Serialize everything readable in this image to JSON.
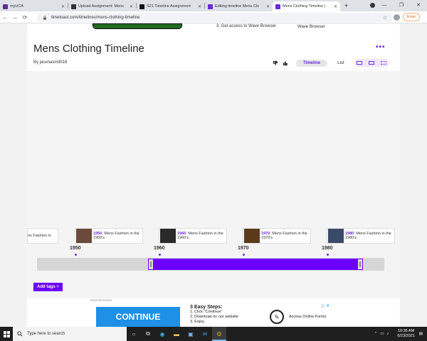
{
  "browser": {
    "tabs": [
      {
        "label": "myUCA",
        "color": "#5c2d91",
        "active": false
      },
      {
        "label": "Upload Assignment: Mens",
        "color": "#333333",
        "active": false
      },
      {
        "label": "S21 Timeline Assignment",
        "color": "#111111",
        "active": false
      },
      {
        "label": "Editing timeline Mens Clo",
        "color": "#6b28e0",
        "active": false
      },
      {
        "label": "Mens Clothing Timeline |",
        "color": "#6b28e0",
        "active": true
      }
    ],
    "new_tab": "+",
    "url": "timetoast.com/timelines/mens-clothing-timeline",
    "error_label": "Error"
  },
  "top_ad": {
    "line1": "3. Get access to Wave Browser",
    "line2": "Wave Browser"
  },
  "page": {
    "title": "Mens Clothing Timeline",
    "byline_prefix": "By",
    "author": "jacenasmith16",
    "more": "•••",
    "view_timeline": "Timeline",
    "view_list": "List",
    "add_tags": "Add tags +"
  },
  "events": [
    {
      "year": "",
      "text": "ns Fashion in",
      "thumb": "#8a7a6a"
    },
    {
      "year": "1950",
      "text": ": Mens Fashion in the 1950's",
      "thumb": "#6a4a3a"
    },
    {
      "year": "1960",
      "text": ": Mens Fashion in the 1960's",
      "thumb": "#2a2a2a"
    },
    {
      "year": "1970",
      "text": ": Mens Fashion in the 1970's",
      "thumb": "#5a3a1a"
    },
    {
      "year": "1980",
      "text": ": Mens Fashion in the 1980's",
      "thumb": "#3a4a6a"
    }
  ],
  "axis": [
    "1950",
    "1960",
    "1970",
    "1980"
  ],
  "ad": {
    "label": "Advertisements",
    "button": "CONTINUE",
    "heading": "3 Easy Steps:",
    "step1": "1. Click \"Continue\"",
    "step2": "2. Download on our website",
    "step3": "3. Enjoy",
    "forms": "Access Online Forms",
    "x": "▷ ✕"
  },
  "taskbar": {
    "search_placeholder": "Type here to search",
    "time": "10:35 AM",
    "date": "6/23/2021"
  },
  "colors": {
    "accent": "#6b00ff",
    "brand_purple": "#6b28e0"
  }
}
